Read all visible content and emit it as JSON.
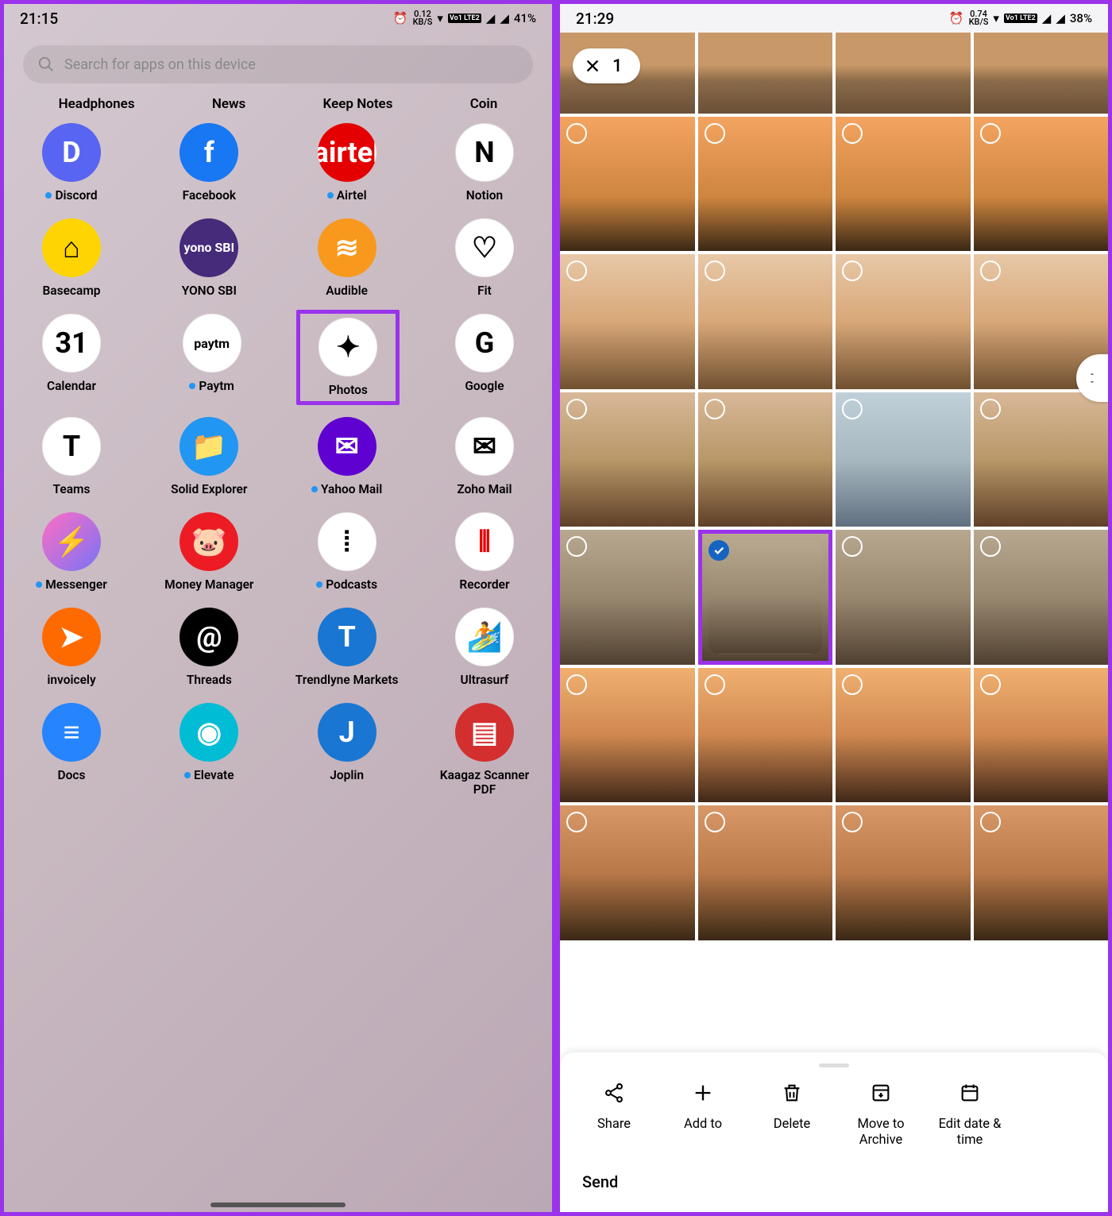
{
  "left": {
    "status": {
      "time": "21:15",
      "speed_top": "0.12",
      "speed_bot": "KB/S",
      "lte": "Vo1 LTE2",
      "battery": "41%"
    },
    "search_placeholder": "Search for apps on this device",
    "folders": [
      "Headphones",
      "News",
      "Keep Notes",
      "Coin"
    ],
    "apps": [
      [
        {
          "label": "Discord",
          "dot": true,
          "ic": "discord",
          "g": "D"
        },
        {
          "label": "Facebook",
          "dot": false,
          "ic": "facebook",
          "g": "f"
        },
        {
          "label": "Airtel",
          "dot": true,
          "ic": "airtel",
          "g": "airtel"
        },
        {
          "label": "Notion",
          "dot": false,
          "ic": "notion",
          "g": "N"
        }
      ],
      [
        {
          "label": "Basecamp",
          "dot": false,
          "ic": "basecamp",
          "g": "⌂"
        },
        {
          "label": "YONO SBI",
          "dot": false,
          "ic": "yono",
          "g": "yono SBI"
        },
        {
          "label": "Audible",
          "dot": false,
          "ic": "audible",
          "g": "≋"
        },
        {
          "label": "Fit",
          "dot": false,
          "ic": "fit",
          "g": "♡"
        }
      ],
      [
        {
          "label": "Calendar",
          "dot": false,
          "ic": "calendar",
          "g": "31"
        },
        {
          "label": "Paytm",
          "dot": true,
          "ic": "paytm",
          "g": "paytm"
        },
        {
          "label": "Photos",
          "dot": false,
          "ic": "photos",
          "g": "✦",
          "hl": true
        },
        {
          "label": "Google",
          "dot": false,
          "ic": "google",
          "g": "G"
        }
      ],
      [
        {
          "label": "Teams",
          "dot": false,
          "ic": "teams",
          "g": "T"
        },
        {
          "label": "Solid Explorer",
          "dot": false,
          "ic": "solidexplorer",
          "g": "📁"
        },
        {
          "label": "Yahoo Mail",
          "dot": true,
          "ic": "yahoo",
          "g": "✉"
        },
        {
          "label": "Zoho Mail",
          "dot": false,
          "ic": "zoho",
          "g": "✉"
        }
      ],
      [
        {
          "label": "Messenger",
          "dot": true,
          "ic": "messenger",
          "g": "⚡"
        },
        {
          "label": "Money Manager",
          "dot": false,
          "ic": "money",
          "g": "🐷"
        },
        {
          "label": "Podcasts",
          "dot": true,
          "ic": "podcasts",
          "g": "⦙"
        },
        {
          "label": "Recorder",
          "dot": false,
          "ic": "recorder",
          "g": "⦀"
        }
      ],
      [
        {
          "label": "invoicely",
          "dot": false,
          "ic": "invoicely",
          "g": "➤"
        },
        {
          "label": "Threads",
          "dot": false,
          "ic": "threads",
          "g": "@"
        },
        {
          "label": "Trendlyne Markets",
          "dot": false,
          "ic": "trendlyne",
          "g": "T"
        },
        {
          "label": "Ultrasurf",
          "dot": false,
          "ic": "ultrasurf",
          "g": "🏄"
        }
      ],
      [
        {
          "label": "Docs",
          "dot": false,
          "ic": "docs",
          "g": "≡"
        },
        {
          "label": "Elevate",
          "dot": true,
          "ic": "elevate",
          "g": "◉"
        },
        {
          "label": "Joplin",
          "dot": false,
          "ic": "joplin",
          "g": "J"
        },
        {
          "label": "Kaagaz Scanner PDF",
          "dot": false,
          "ic": "kaagaz",
          "g": "▤"
        }
      ]
    ]
  },
  "right": {
    "status": {
      "time": "21:29",
      "speed_top": "0.74",
      "speed_bot": "KB/S",
      "lte": "Vo1 LTE2",
      "battery": "38%"
    },
    "selected_count": "1",
    "actions": [
      {
        "label": "Share",
        "icon": "share"
      },
      {
        "label": "Add to",
        "icon": "plus"
      },
      {
        "label": "Delete",
        "icon": "trash"
      },
      {
        "label": "Move to Archive",
        "icon": "archive"
      },
      {
        "label": "Edit date & time",
        "icon": "cal"
      }
    ],
    "send_label": "Send"
  }
}
